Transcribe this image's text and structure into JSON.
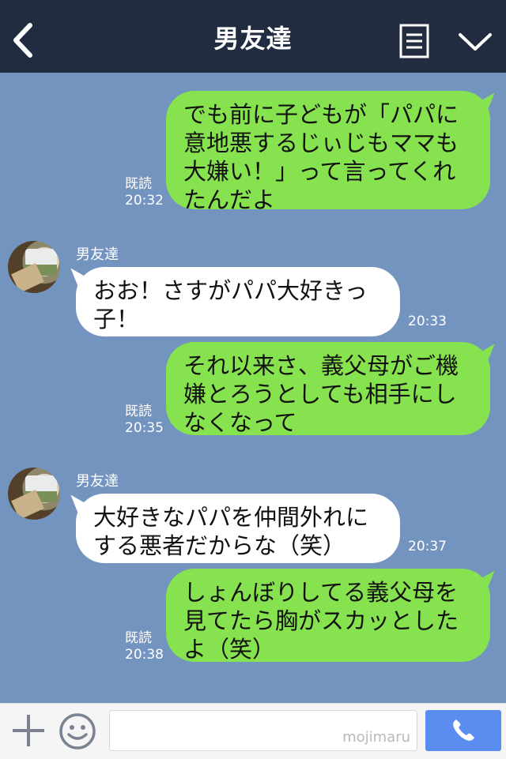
{
  "header": {
    "title": "男友達"
  },
  "messages": [
    {
      "side": "out",
      "text": "でも前に子どもが「パパに\n意地悪するじぃじもママも\n大嫌い！」って言ってくれ\nたんだよ",
      "read": "既読",
      "time": "20:32"
    },
    {
      "side": "in",
      "sender": "男友達",
      "text": "おお！さすがパパ大好きっ\n子！",
      "time": "20:33"
    },
    {
      "side": "out",
      "text": "それ以来さ、義父母がご機\n嫌とろうとしても相手にし\nなくなって",
      "read": "既読",
      "time": "20:35"
    },
    {
      "side": "in",
      "sender": "男友達",
      "text": "大好きなパパを仲間外れに\nする悪者だからな（笑）",
      "time": "20:37"
    },
    {
      "side": "out",
      "text": "しょんぼりしてる義父母を\n見てたら胸がスカッとした\nよ（笑）",
      "read": "既読",
      "time": "20:38"
    }
  ],
  "footer": {
    "watermark": "mojimaru"
  },
  "icons": {
    "back": "back-chevron-icon",
    "menu": "menu-icon",
    "dropdown": "chevron-down-icon",
    "add": "plus-icon",
    "emoji": "smile-icon",
    "call": "phone-icon"
  },
  "colors": {
    "header_bg": "#222c40",
    "chat_bg": "#7494c0",
    "out_bubble": "#86e24e",
    "in_bubble": "#ffffff",
    "call_button": "#5b8cf0"
  }
}
